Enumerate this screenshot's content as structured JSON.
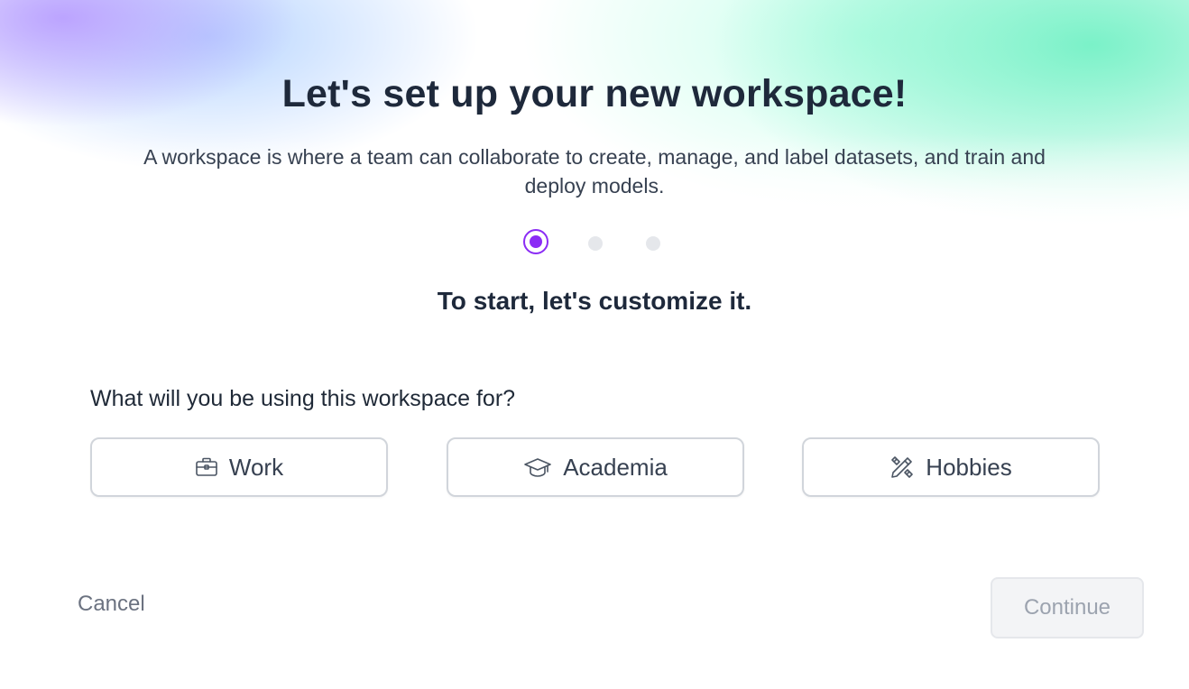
{
  "header": {
    "title": "Let's set up your new workspace!",
    "subtitle": "A workspace is where a team can collaborate to create, manage, and label datasets, and train and deploy models."
  },
  "stepper": {
    "current_step": 1,
    "total_steps": 3,
    "active_color": "#8b2cf5",
    "inactive_color": "#e5e7eb"
  },
  "section": {
    "title": "To start, let's customize it."
  },
  "usage": {
    "question": "What will you be using this workspace for?",
    "options": [
      {
        "label": "Work",
        "icon": "briefcase-icon"
      },
      {
        "label": "Academia",
        "icon": "graduation-cap-icon"
      },
      {
        "label": "Hobbies",
        "icon": "pencil-ruler-icon"
      }
    ]
  },
  "footer": {
    "cancel_label": "Cancel",
    "continue_label": "Continue",
    "continue_disabled": true
  }
}
